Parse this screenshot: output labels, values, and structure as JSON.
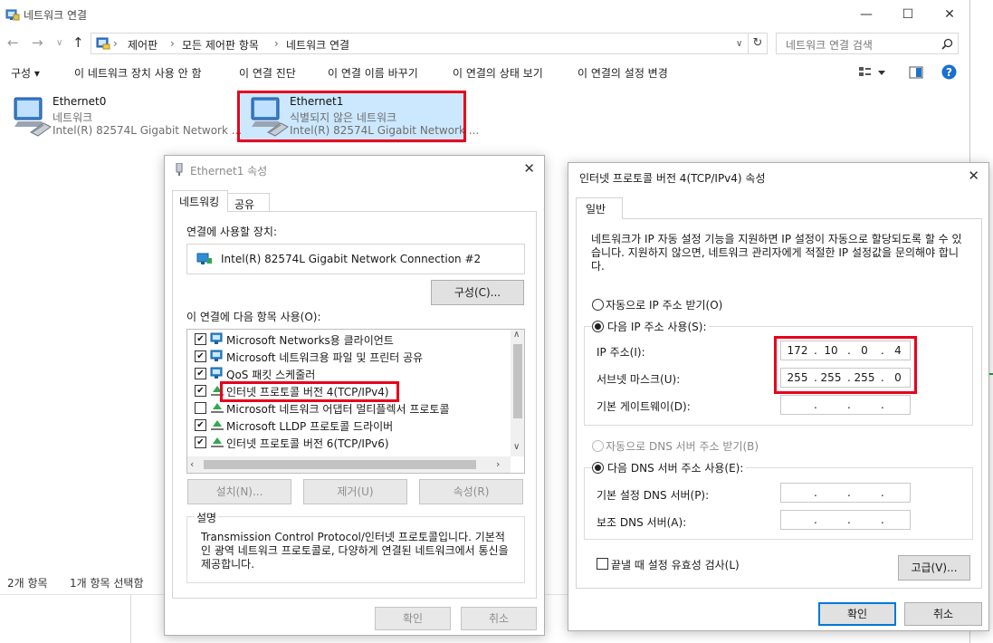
{
  "explorer": {
    "title": "네트워크 연결",
    "address": [
      "제어판",
      "모든 제어판 항목",
      "네트워크 연결"
    ],
    "search_placeholder": "네트워크 연결 검색",
    "commands": {
      "organize": "구성 ▾",
      "disable": "이 네트워크 장치 사용 안 함",
      "diagnose": "이 연결 진단",
      "rename": "이 연결 이름 바꾸기",
      "status": "이 연결의 상태 보기",
      "change_settings": "이 연결의 설정 변경"
    },
    "adapters": [
      {
        "name": "Ethernet0",
        "status": "네트워크",
        "device": "Intel(R) 82574L Gigabit Network ..."
      },
      {
        "name": "Ethernet1",
        "status": "식별되지 않은 네트워크",
        "device": "Intel(R) 82574L Gigabit Network ..."
      }
    ],
    "statusbar": {
      "count": "2개 항목",
      "selected": "1개 항목 선택함"
    }
  },
  "props": {
    "title": "Ethernet1 속성",
    "tabs": [
      "네트워킹",
      "공유"
    ],
    "connect_using_label": "연결에 사용할 장치:",
    "device": "Intel(R) 82574L Gigabit Network Connection #2",
    "configure_button": "구성(C)...",
    "items_label": "이 연결에 다음 항목 사용(O):",
    "items": [
      {
        "label": "Microsoft Networks용 클라이언트",
        "checked": true
      },
      {
        "label": "Microsoft 네트워크용 파일 및 프린터 공유",
        "checked": true
      },
      {
        "label": "QoS 패킷 스케줄러",
        "checked": true
      },
      {
        "label": "인터넷 프로토콜 버전 4(TCP/IPv4)",
        "checked": true
      },
      {
        "label": "Microsoft 네트워크 어댑터 멀티플렉서 프로토콜",
        "checked": false
      },
      {
        "label": "Microsoft LLDP 프로토콜 드라이버",
        "checked": true
      },
      {
        "label": "인터넷 프로토콜 버전 6(TCP/IPv6)",
        "checked": true
      }
    ],
    "install_button": "설치(N)...",
    "uninstall_button": "제거(U)",
    "properties_button": "속성(R)",
    "description_label": "설명",
    "description": "Transmission Control Protocol/인터넷 프로토콜입니다. 기본적인 광역 네트워크 프로토콜로, 다양하게 연결된 네트워크에서 통신을 제공합니다.",
    "ok_button": "확인",
    "cancel_button": "취소"
  },
  "ipv4": {
    "title": "인터넷 프로토콜 버전 4(TCP/IPv4) 속성",
    "tab": "일반",
    "info": "네트워크가 IP 자동 설정 기능을 지원하면 IP 설정이 자동으로 할당되도록 할 수 있습니다. 지원하지 않으면, 네트워크 관리자에게 적절한 IP 설정값을 문의해야 합니다.",
    "auto_ip": "자동으로 IP 주소 받기(O)",
    "manual_ip": "다음 IP 주소 사용(S):",
    "ip_label": "IP 주소(I):",
    "ip": [
      "172",
      "10",
      "0",
      "4"
    ],
    "mask_label": "서브넷 마스크(U):",
    "mask": [
      "255",
      "255",
      "255",
      "0"
    ],
    "gateway_label": "기본 게이트웨이(D):",
    "auto_dns": "자동으로 DNS 서버 주소 받기(B)",
    "manual_dns": "다음 DNS 서버 주소 사용(E):",
    "preferred_dns_label": "기본 설정 DNS 서버(P):",
    "alternate_dns_label": "보조 DNS 서버(A):",
    "validate_label": "끝낼 때 설정 유효성 검사(L)",
    "advanced_button": "고급(V)...",
    "ok_button": "확인",
    "cancel_button": "취소"
  }
}
